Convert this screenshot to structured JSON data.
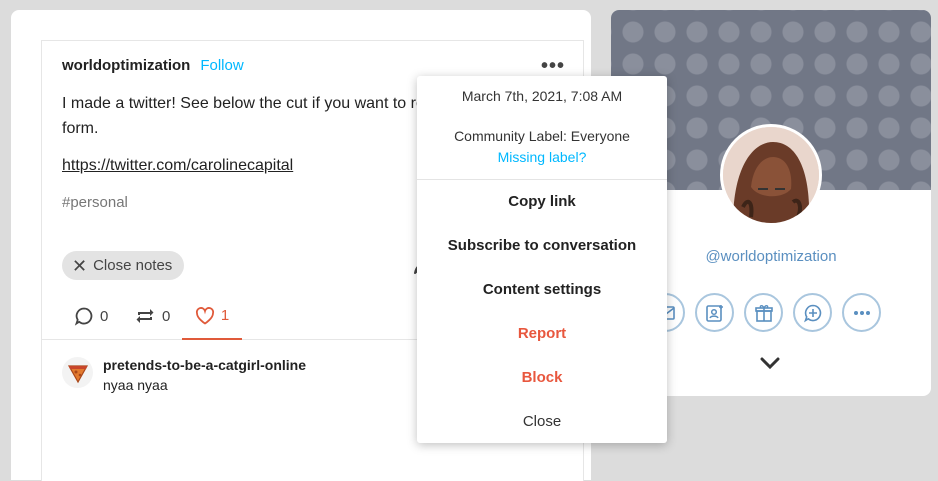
{
  "post": {
    "blog_name": "worldoptimization",
    "follow_label": "Follow",
    "more_label": "•••",
    "body_text": "I made a twitter! See below the cut if you want to re from me in tweet form.",
    "link_text": "https://twitter.com/carolinecapital",
    "tag": "#personal",
    "close_notes_label": "Close notes",
    "close_icon": "✕"
  },
  "notes": {
    "replies_count": "0",
    "reblogs_count": "0",
    "likes_count": "1",
    "items": [
      {
        "name": "pretends-to-be-a-catgirl-online",
        "text": "nyaa nyaa"
      }
    ]
  },
  "menu": {
    "date": "March 7th, 2021, 7:08 AM",
    "community_label": "Community Label: Everyone",
    "missing_label": "Missing label?",
    "items": [
      "Copy link",
      "Subscribe to conversation",
      "Content settings",
      "Report",
      "Block",
      "Close"
    ]
  },
  "blog_card": {
    "url": "@worldoptimization",
    "actions": [
      "mail-icon",
      "user-card-icon",
      "gift-icon",
      "chat-plus-icon",
      "more-icon"
    ]
  },
  "colors": {
    "accent_blue": "#00b8ff",
    "danger": "#e8573e",
    "like": "#e05a3a",
    "header_bg": "#717786"
  }
}
